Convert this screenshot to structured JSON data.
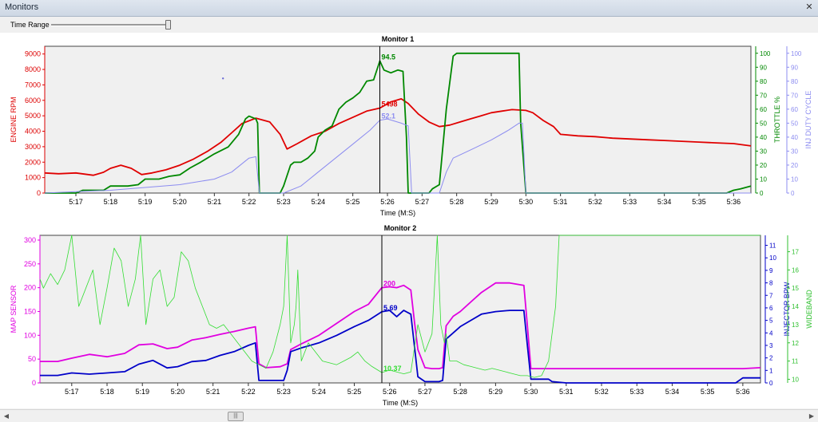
{
  "window": {
    "title": "Monitors",
    "close_label": "✕"
  },
  "toolbar": {
    "time_range_label": "Time Range",
    "time_range_fraction": 0.99
  },
  "scrollbar": {
    "left_arrow": "◀",
    "right_arrow": "▶",
    "thumb_label": "|||",
    "position_fraction": 0.28
  },
  "chart_data": [
    {
      "type": "line",
      "title": "Monitor 1",
      "xlabel": "Time (M:S)",
      "x_range": [
        316.1,
        336.5
      ],
      "x_ticks": [
        317,
        318,
        319,
        320,
        321,
        322,
        323,
        324,
        325,
        326,
        327,
        328,
        329,
        330,
        331,
        332,
        333,
        334,
        335,
        336
      ],
      "x_tick_labels": [
        "5:17",
        "5:18",
        "5:19",
        "5:20",
        "5:21",
        "5:22",
        "5:23",
        "5:24",
        "5:25",
        "5:26",
        "5:27",
        "5:28",
        "5:29",
        "5:30",
        "5:31",
        "5:32",
        "5:33",
        "5:34",
        "5:35",
        "5:36"
      ],
      "cursor_x": 325.78,
      "grid": false,
      "axes": [
        {
          "side": "left",
          "label": "ENGINE RPM",
          "color": "#dd0000",
          "range": [
            0,
            9500
          ],
          "ticks": [
            0,
            1000,
            2000,
            3000,
            4000,
            5000,
            6000,
            7000,
            8000,
            9000
          ]
        },
        {
          "side": "right",
          "label": "THROTTLE %",
          "color": "#008800",
          "range": [
            0,
            105
          ],
          "ticks": [
            0,
            10,
            20,
            30,
            40,
            50,
            60,
            70,
            80,
            90,
            100
          ]
        },
        {
          "side": "right",
          "label": "INJ DUTY CYCLE",
          "color": "#8c8cf0",
          "range": [
            0,
            105
          ],
          "ticks": [
            0,
            10,
            20,
            30,
            40,
            50,
            60,
            70,
            80,
            90,
            100
          ]
        }
      ],
      "series": [
        {
          "axis": 0,
          "color": "#e00000",
          "width": 1.8,
          "cursor_label": "5498",
          "x": [
            316.1,
            316.5,
            317,
            317.5,
            317.8,
            318,
            318.3,
            318.6,
            318.9,
            319.2,
            319.6,
            320,
            320.4,
            320.8,
            321.2,
            321.5,
            321.8,
            322.2,
            322.6,
            322.9,
            323.1,
            323.4,
            323.8,
            324.2,
            324.6,
            325,
            325.4,
            325.78,
            326.1,
            326.4,
            326.6,
            326.9,
            327.2,
            327.5,
            327.8,
            328.1,
            328.4,
            328.7,
            329,
            329.3,
            329.6,
            330,
            330.2,
            330.5,
            330.8,
            331,
            331.5,
            332,
            332.5,
            333,
            333.5,
            334,
            334.5,
            335,
            335.5,
            336,
            336.5
          ],
          "y": [
            1300,
            1250,
            1300,
            1150,
            1350,
            1600,
            1800,
            1600,
            1200,
            1300,
            1500,
            1800,
            2200,
            2700,
            3300,
            3900,
            4500,
            4850,
            4600,
            3800,
            2850,
            3200,
            3700,
            4000,
            4500,
            4900,
            5300,
            5498,
            5900,
            6100,
            5800,
            5100,
            4600,
            4300,
            4400,
            4600,
            4800,
            5000,
            5200,
            5300,
            5400,
            5350,
            5200,
            4700,
            4300,
            3800,
            3700,
            3650,
            3550,
            3500,
            3450,
            3400,
            3350,
            3300,
            3250,
            3200,
            3050
          ]
        },
        {
          "axis": 1,
          "color": "#008800",
          "width": 1.8,
          "cursor_label": "94.5",
          "x": [
            316.1,
            316.3,
            316.5,
            317,
            317.2,
            317.5,
            317.8,
            318,
            318.5,
            318.8,
            319,
            319.4,
            319.7,
            320,
            320.3,
            320.6,
            321,
            321.4,
            321.7,
            321.9,
            322,
            322.2,
            322.25,
            322.3,
            322.9,
            323,
            323.2,
            323.3,
            323.5,
            323.7,
            323.9,
            324,
            324.2,
            324.4,
            324.6,
            324.8,
            325,
            325.2,
            325.4,
            325.6,
            325.78,
            325.9,
            326.1,
            326.3,
            326.45,
            326.55,
            326.6,
            326.65,
            326.8,
            327.2,
            327.3,
            327.5,
            327.7,
            327.9,
            328,
            328.3,
            328.6,
            329,
            329.4,
            329.6,
            329.8,
            329.85,
            330,
            330.5,
            331,
            332,
            333,
            334,
            335,
            335.5,
            335.8,
            336,
            336.2,
            336.5
          ],
          "y": [
            0,
            0,
            0,
            0,
            2,
            2,
            2,
            5,
            5,
            6,
            10,
            10,
            12,
            13,
            18,
            22,
            28,
            33,
            42,
            53,
            55,
            53,
            50,
            0,
            0,
            5,
            20,
            22,
            22,
            25,
            30,
            40,
            45,
            48,
            60,
            65,
            68,
            72,
            80,
            81,
            94.5,
            88,
            86,
            88,
            87,
            40,
            0,
            0,
            0,
            0,
            3,
            6,
            60,
            98,
            100,
            100,
            100,
            100,
            100,
            100,
            100,
            50,
            0,
            0,
            0,
            0,
            0,
            0,
            0,
            0,
            0,
            2,
            3,
            5
          ]
        },
        {
          "axis": 2,
          "color": "#8c8cf0",
          "width": 1.0,
          "cursor_label": "52.1",
          "x": [
            316.1,
            317,
            318,
            319,
            320,
            321,
            321.5,
            322,
            322.2,
            322.3,
            323,
            323.5,
            324,
            324.5,
            325,
            325.5,
            325.78,
            326,
            326.4,
            326.6,
            326.7,
            327.5,
            327.7,
            327.9,
            328.5,
            329,
            329.5,
            329.8,
            329.9,
            330,
            331,
            332,
            333,
            334,
            335,
            336,
            336.5
          ],
          "y": [
            0,
            1,
            2,
            4,
            6,
            10,
            15,
            25,
            26,
            0,
            0,
            5,
            15,
            25,
            35,
            45,
            52.1,
            53,
            50,
            48,
            0,
            0,
            15,
            25,
            32,
            38,
            45,
            50,
            50,
            0,
            0,
            0,
            0,
            0,
            0,
            0,
            0
          ]
        },
        {
          "axis": 2,
          "color": "#6b6bd6",
          "width": 0,
          "marker": true,
          "x": [
            321.25
          ],
          "y": [
            82
          ]
        }
      ]
    },
    {
      "type": "line",
      "title": "Monitor 2",
      "xlabel": "Time (M:S)",
      "x_range": [
        316.1,
        336.5
      ],
      "x_ticks": [
        317,
        318,
        319,
        320,
        321,
        322,
        323,
        324,
        325,
        326,
        327,
        328,
        329,
        330,
        331,
        332,
        333,
        334,
        335,
        336
      ],
      "x_tick_labels": [
        "5:17",
        "5:18",
        "5:19",
        "5:20",
        "5:21",
        "5:22",
        "5:23",
        "5:24",
        "5:25",
        "5:26",
        "5:27",
        "5:28",
        "5:29",
        "5:30",
        "5:31",
        "5:32",
        "5:33",
        "5:34",
        "5:35",
        "5:36"
      ],
      "cursor_x": 325.78,
      "grid": false,
      "axes": [
        {
          "side": "left",
          "label": "MAP SENSOR",
          "color": "#e000e0",
          "range": [
            0,
            310
          ],
          "ticks": [
            0,
            50,
            100,
            150,
            200,
            250,
            300
          ]
        },
        {
          "side": "right",
          "label": "INJECTOR BPW",
          "color": "#0000c8",
          "range": [
            0,
            11.8
          ],
          "ticks": [
            0,
            1,
            2,
            3,
            4,
            5,
            6,
            7,
            8,
            9,
            10,
            11
          ]
        },
        {
          "side": "right",
          "label": "WIDEBAND",
          "color": "#30c030",
          "range": [
            9.8,
            17.9
          ],
          "ticks": [
            10,
            11,
            12,
            13,
            14,
            15,
            16,
            17
          ]
        }
      ],
      "series": [
        {
          "axis": 0,
          "color": "#e000e0",
          "width": 1.8,
          "cursor_label": "200",
          "x": [
            316.1,
            316.6,
            317,
            317.5,
            318,
            318.5,
            318.9,
            319.3,
            319.7,
            320,
            320.4,
            320.8,
            321.2,
            321.6,
            322,
            322.2,
            322.3,
            322.5,
            322.9,
            323.1,
            323.2,
            323.5,
            324,
            324.5,
            325,
            325.4,
            325.78,
            326,
            326.2,
            326.4,
            326.6,
            326.7,
            326.8,
            327,
            327.2,
            327.4,
            327.5,
            327.6,
            327.8,
            328,
            328.3,
            328.6,
            329,
            329.4,
            329.8,
            329.9,
            330,
            330.5,
            331,
            332,
            333,
            334,
            335,
            336,
            336.5
          ],
          "y": [
            45,
            45,
            52,
            60,
            55,
            62,
            80,
            82,
            72,
            75,
            90,
            95,
            102,
            108,
            115,
            118,
            40,
            32,
            34,
            40,
            70,
            82,
            100,
            125,
            150,
            165,
            200,
            202,
            200,
            205,
            195,
            130,
            70,
            32,
            30,
            30,
            32,
            120,
            140,
            150,
            170,
            190,
            210,
            210,
            205,
            120,
            30,
            30,
            30,
            30,
            30,
            30,
            30,
            30,
            32
          ]
        },
        {
          "axis": 1,
          "color": "#0000c8",
          "width": 1.8,
          "cursor_label": "5.69",
          "x": [
            316.1,
            316.6,
            317,
            317.5,
            318,
            318.5,
            318.9,
            319.3,
            319.7,
            320,
            320.4,
            320.8,
            321.2,
            321.6,
            322,
            322.2,
            322.3,
            322.9,
            323.0,
            323.1,
            323.2,
            323.5,
            324,
            324.5,
            325,
            325.4,
            325.78,
            326,
            326.2,
            326.4,
            326.6,
            326.7,
            326.8,
            327.0,
            327.2,
            327.4,
            327.5,
            327.6,
            327.8,
            328,
            328.3,
            328.6,
            329,
            329.4,
            329.8,
            329.9,
            330,
            330.5,
            330.6,
            331,
            332,
            333,
            334,
            335,
            335.8,
            336,
            336.5
          ],
          "y": [
            0.6,
            0.6,
            0.8,
            0.7,
            0.8,
            0.9,
            1.5,
            1.8,
            1.2,
            1.3,
            1.7,
            1.8,
            2.2,
            2.5,
            3,
            3.2,
            0.2,
            0.2,
            0.2,
            1,
            2.5,
            2.8,
            3.2,
            3.8,
            4.5,
            5,
            5.69,
            5.8,
            5.3,
            5.8,
            5.5,
            3,
            0.5,
            0.1,
            0.1,
            0.1,
            0.2,
            3.5,
            4,
            4.5,
            5,
            5.5,
            5.7,
            5.8,
            5.8,
            3,
            0.3,
            0.3,
            0.1,
            0,
            0,
            0,
            0,
            0,
            0,
            0.4,
            0.4
          ]
        },
        {
          "axis": 2,
          "color": "#33dd33",
          "width": 0.8,
          "cursor_label": "10.37",
          "x": [
            316.1,
            316.2,
            316.4,
            316.6,
            316.8,
            317,
            317.2,
            317.4,
            317.6,
            317.8,
            318,
            318.2,
            318.4,
            318.6,
            318.8,
            318.95,
            319.1,
            319.3,
            319.5,
            319.7,
            319.9,
            320.1,
            320.3,
            320.5,
            320.7,
            320.9,
            321.1,
            321.3,
            321.5,
            321.7,
            321.9,
            322.1,
            322.3,
            322.5,
            322.7,
            322.9,
            323.0,
            323.1,
            323.2,
            323.3,
            323.35,
            323.4,
            323.5,
            323.7,
            323.9,
            324.1,
            324.3,
            324.5,
            324.7,
            324.9,
            325.1,
            325.3,
            325.5,
            325.78,
            326,
            326.2,
            326.4,
            326.6,
            326.8,
            327,
            327.2,
            327.35,
            327.45,
            327.55,
            327.6,
            327.7,
            327.9,
            328.1,
            328.3,
            328.5,
            328.7,
            328.9,
            329.1,
            329.3,
            329.5,
            329.7,
            329.9,
            330.1,
            330.3,
            330.5,
            330.7,
            330.8,
            331,
            332,
            333,
            334,
            335,
            336,
            336.5
          ],
          "y": [
            15.5,
            15,
            15.8,
            15.2,
            16,
            17.9,
            14,
            15,
            16,
            13,
            15,
            17.2,
            16.5,
            14,
            15.5,
            17.9,
            13,
            15.5,
            16,
            14,
            14.5,
            17,
            16.5,
            15,
            14,
            13,
            12.8,
            13,
            12.5,
            12,
            11.5,
            11,
            10.8,
            10.6,
            11.5,
            13,
            14,
            17.9,
            12,
            13,
            14,
            16,
            11,
            12,
            11.5,
            11,
            10.9,
            10.8,
            11,
            11.2,
            11.5,
            11,
            10.7,
            10.37,
            10.5,
            10.4,
            10.3,
            10.4,
            13,
            11.5,
            12.5,
            17.9,
            13,
            12,
            12.5,
            11,
            11,
            10.8,
            10.7,
            10.6,
            10.5,
            10.6,
            10.5,
            10.4,
            10.3,
            10.2,
            10.2,
            10.1,
            10.2,
            11,
            14,
            17.9,
            17.9,
            17.9,
            17.9,
            17.9,
            17.9,
            17.9,
            17.9
          ]
        }
      ]
    }
  ]
}
